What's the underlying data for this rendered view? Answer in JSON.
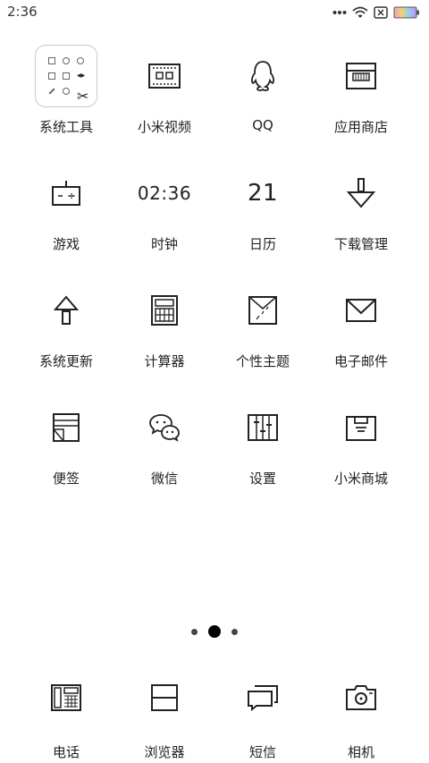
{
  "status_bar": {
    "time": "2:36",
    "icons": [
      "more-dots-icon",
      "wifi-icon",
      "no-sim-icon",
      "battery-icon"
    ]
  },
  "apps": [
    {
      "label": "系统工具",
      "icon": "folder-icon"
    },
    {
      "label": "小米视频",
      "icon": "video-icon"
    },
    {
      "label": "QQ",
      "icon": "qq-penguin-icon"
    },
    {
      "label": "应用商店",
      "icon": "app-store-icon"
    },
    {
      "label": "游戏",
      "icon": "gamepad-icon"
    },
    {
      "label": "时钟",
      "icon_text": "02:36"
    },
    {
      "label": "日历",
      "icon_text": "21"
    },
    {
      "label": "下载管理",
      "icon": "download-icon"
    },
    {
      "label": "系统更新",
      "icon": "update-arrow-icon"
    },
    {
      "label": "计算器",
      "icon": "calculator-icon"
    },
    {
      "label": "个性主题",
      "icon": "theme-shirt-icon"
    },
    {
      "label": "电子邮件",
      "icon": "mail-icon"
    },
    {
      "label": "便签",
      "icon": "notes-icon"
    },
    {
      "label": "微信",
      "icon": "wechat-icon"
    },
    {
      "label": "设置",
      "icon": "settings-sliders-icon"
    },
    {
      "label": "小米商城",
      "icon": "mi-store-icon"
    }
  ],
  "page_indicator": {
    "pages": 3,
    "current": 2
  },
  "dock": [
    {
      "label": "电话",
      "icon": "phone-icon"
    },
    {
      "label": "浏览器",
      "icon": "browser-icon"
    },
    {
      "label": "短信",
      "icon": "messages-icon"
    },
    {
      "label": "相机",
      "icon": "camera-icon"
    }
  ]
}
